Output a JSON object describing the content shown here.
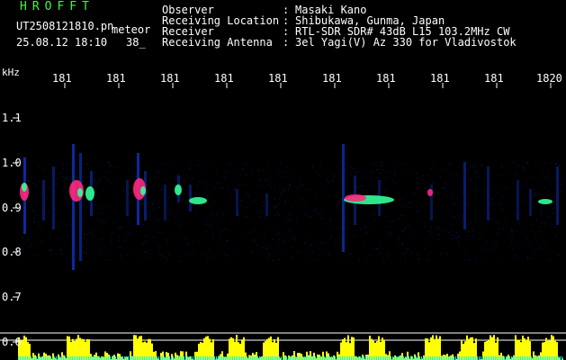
{
  "header": {
    "app_title": "HROFFT",
    "file_name": "UT2508121810.pn",
    "file_tag": "meteor",
    "date_time": "25.08.12 18:10",
    "count": "38_",
    "meta": [
      {
        "label": "Observer",
        "value": "Masaki Kano"
      },
      {
        "label": "Receiving Location",
        "value": "Shibukawa, Gunma, Japan"
      },
      {
        "label": "Receiver",
        "value": "RTL-SDR SDR# 43dB L15 103.2MHz CW"
      },
      {
        "label": "Receiving Antenna",
        "value": "3el Yagi(V) Az 330 for Vladivostok"
      }
    ]
  },
  "axes": {
    "unit": "kHz",
    "x_ticks": [
      "181",
      "181",
      "181",
      "181",
      "181",
      "181",
      "181",
      "181",
      "181",
      "1820"
    ],
    "y_ticks": [
      "1.1",
      "1.0",
      "0.9",
      "0.8",
      "0.7",
      "0.6"
    ]
  },
  "colors": {
    "background": "#000000",
    "text": "#ffffff",
    "title": "#33ff33",
    "grid": "#ffffff",
    "noise": "#0b2a9e",
    "echo_hot": "#ff2a80",
    "echo_warm": "#33ff99",
    "meter": "#ffff00",
    "meter_base": "#00ffff"
  }
}
